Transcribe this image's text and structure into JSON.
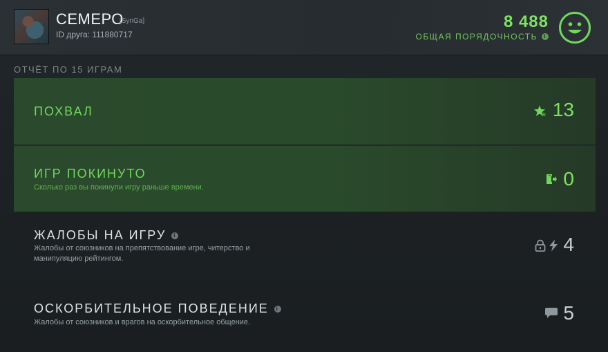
{
  "profile": {
    "name": "СЕМЕРО",
    "clan_tag": "[SynGa]",
    "friend_id": "ID друга: 111880717"
  },
  "behavior": {
    "score": "8 488",
    "label": "ОБЩАЯ ПОРЯДОЧНОСТЬ",
    "info_icon": "i",
    "mood_icon": "smiley-face-icon",
    "accent_color": "#7fe263"
  },
  "report": {
    "title": "ОТЧЁТ ПО 15 ИГРАМ",
    "rows": [
      {
        "title": "ПОХВАЛ",
        "description": "",
        "value": "13",
        "icon": "star-icon"
      },
      {
        "title": "ИГР ПОКИНУТО",
        "description": "Сколько раз вы покинули игру раньше времени.",
        "value": "0",
        "icon": "exit-door-icon"
      },
      {
        "title": "ЖАЛОБЫ НА ИГРУ",
        "description": "Жалобы от союзников на препятствование игре, читерство и манипуляцию рейтингом.",
        "value": "4",
        "icon": "lock-icon",
        "icon2": "lightning-icon",
        "info_icon": "i"
      },
      {
        "title": "ОСКОРБИТЕЛЬНОЕ ПОВЕДЕНИЕ",
        "description": "Жалобы от союзников и врагов на оскорбительное общение.",
        "value": "5",
        "icon": "chat-bubble-icon",
        "info_icon": "i"
      }
    ]
  }
}
